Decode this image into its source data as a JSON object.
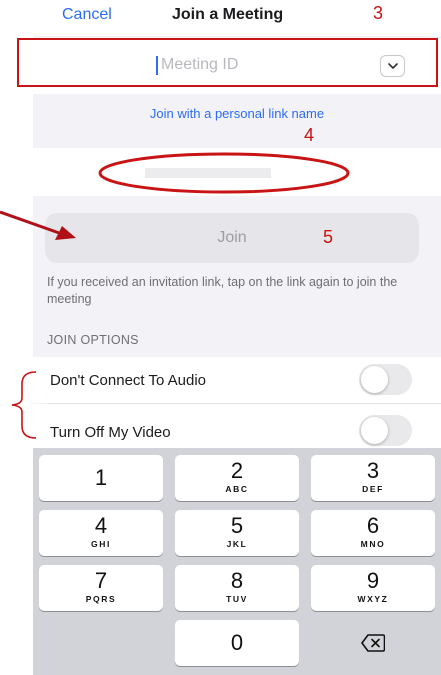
{
  "header": {
    "cancel_label": "Cancel",
    "title": "Join a Meeting"
  },
  "meeting_id": {
    "placeholder": "Meeting ID",
    "dropdown_icon": "chevron-down-icon"
  },
  "personal_link_label": "Join with a personal link name",
  "join_button_label": "Join",
  "hint_text": "If you received an invitation link, tap on the link again to join the meeting",
  "join_options": {
    "section_title": "JOIN OPTIONS",
    "items": [
      {
        "label": "Don't Connect To Audio",
        "enabled": false
      },
      {
        "label": "Turn Off My Video",
        "enabled": false
      }
    ]
  },
  "keypad": {
    "keys": [
      {
        "num": "1",
        "letters": ""
      },
      {
        "num": "2",
        "letters": "ABC"
      },
      {
        "num": "3",
        "letters": "DEF"
      },
      {
        "num": "4",
        "letters": "GHI"
      },
      {
        "num": "5",
        "letters": "JKL"
      },
      {
        "num": "6",
        "letters": "MNO"
      },
      {
        "num": "7",
        "letters": "PQRS"
      },
      {
        "num": "8",
        "letters": "TUV"
      },
      {
        "num": "9",
        "letters": "WXYZ"
      },
      {
        "num": "0",
        "letters": ""
      }
    ],
    "backspace_icon": "backspace-icon"
  },
  "annotations": {
    "n3": "3",
    "n4": "4",
    "n5": "5",
    "color": "#d01010"
  },
  "colors": {
    "accent": "#2d6cf6",
    "background": "#f2f2f7",
    "keypad": "#d1d3d9"
  }
}
